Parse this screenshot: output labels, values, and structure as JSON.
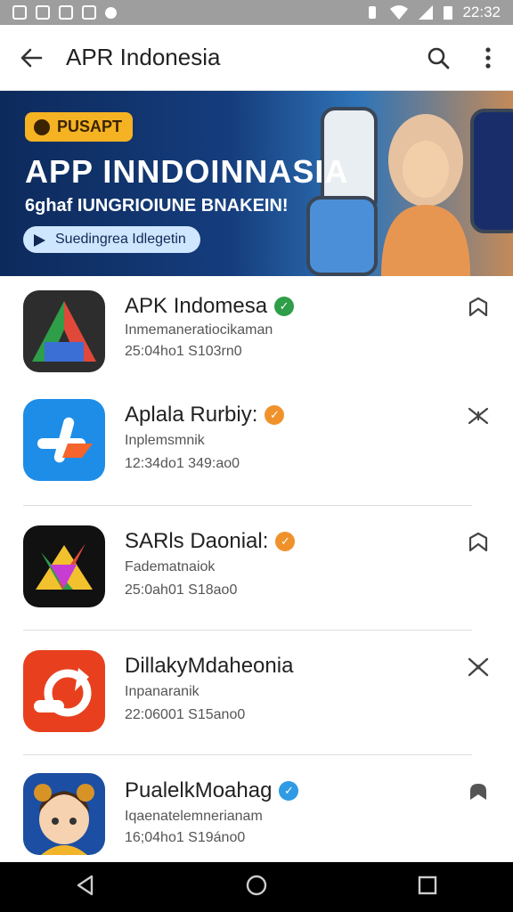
{
  "status_bar": {
    "time": "22:32"
  },
  "app_bar": {
    "title": "APR Indonesia"
  },
  "banner": {
    "badge": "PUSAPT",
    "headline": "APP INNDOINNASIA",
    "subline": "6ghaf IUNGRIOIUNE BNAKEIN!",
    "cta": "Suedingrea Idlegetin"
  },
  "apps": [
    {
      "name": "APK Indomesa",
      "developer": "Inmemaneratiocikaman",
      "meta": "25:04ho1 S103rn0",
      "badge_color": "#2e9e48"
    },
    {
      "name": "Aplala Rurbiy:",
      "developer": "Inplemsmnik",
      "meta": "12:34do1 349:ao0",
      "badge_color": "#f0922b"
    },
    {
      "name": "SARls Daonial:",
      "developer": "Fadematnaiok",
      "meta": "25:0ah01 S18ao0",
      "badge_color": "#f0922b"
    },
    {
      "name": "DillakyMdaheonia",
      "developer": "Inpanaranik",
      "meta": "22:06001 S15ano0",
      "badge_color": ""
    },
    {
      "name": "PualelkMoahag",
      "developer": "Iqaenatelemnerianam",
      "meta": "16;04ho1 S19áno0",
      "badge_color": "#2f9be4"
    }
  ]
}
